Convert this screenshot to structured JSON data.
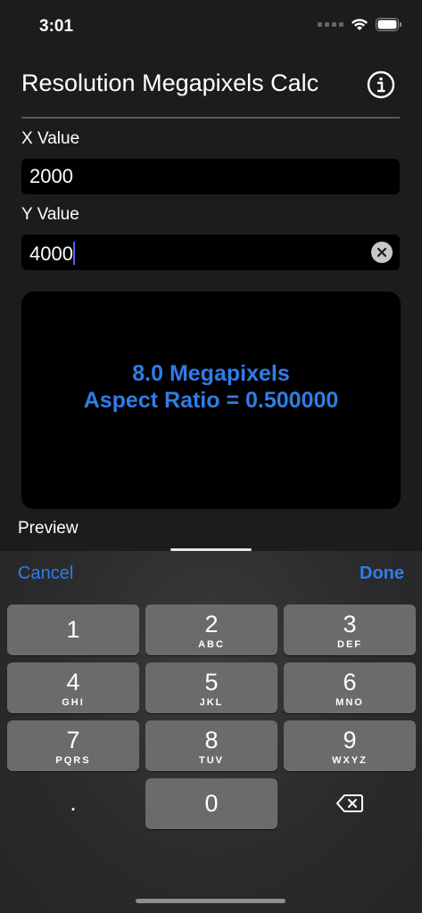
{
  "status_bar": {
    "time": "3:01"
  },
  "nav": {
    "title": "Resolution Megapixels Calc",
    "info_icon": "info-circle-icon"
  },
  "form": {
    "x_label": "X Value",
    "x_value": "2000",
    "y_label": "Y Value",
    "y_value": "4000"
  },
  "result": {
    "megapixels": "8.0 Megapixels",
    "aspect_ratio": "Aspect Ratio = 0.500000",
    "color": "#2f7de7"
  },
  "preview_label": "Preview",
  "keyboard": {
    "cancel": "Cancel",
    "done": "Done",
    "keys": [
      {
        "digit": "1",
        "letters": ""
      },
      {
        "digit": "2",
        "letters": "ABC"
      },
      {
        "digit": "3",
        "letters": "DEF"
      },
      {
        "digit": "4",
        "letters": "GHI"
      },
      {
        "digit": "5",
        "letters": "JKL"
      },
      {
        "digit": "6",
        "letters": "MNO"
      },
      {
        "digit": "7",
        "letters": "PQRS"
      },
      {
        "digit": "8",
        "letters": "TUV"
      },
      {
        "digit": "9",
        "letters": "WXYZ"
      },
      {
        "digit": "0",
        "letters": ""
      }
    ],
    "decimal": ".",
    "delete_icon": "backspace-icon"
  }
}
